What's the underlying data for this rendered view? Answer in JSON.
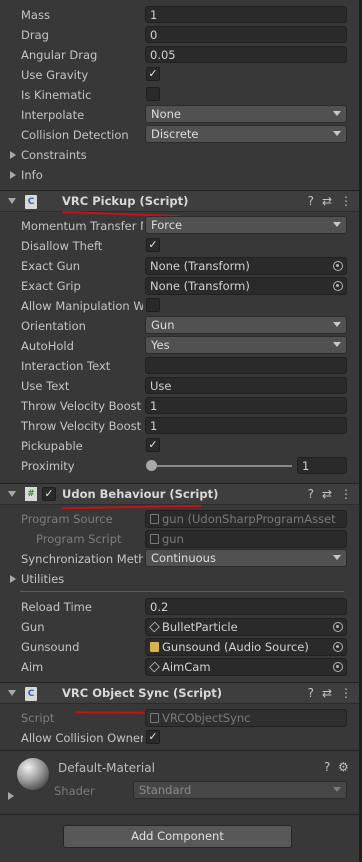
{
  "rigidbody": {
    "rows": [
      {
        "label": "Mass",
        "value": "1"
      },
      {
        "label": "Drag",
        "value": "0"
      },
      {
        "label": "Angular Drag",
        "value": "0.05"
      }
    ],
    "use_gravity_label": "Use Gravity",
    "is_kinematic_label": "Is Kinematic",
    "interpolate_label": "Interpolate",
    "interpolate_value": "None",
    "collision_label": "Collision Detection",
    "collision_value": "Discrete",
    "constraints_label": "Constraints",
    "info_label": "Info"
  },
  "pickup": {
    "title": "VRC Pickup (Script)",
    "momentum_label": "Momentum Transfer M",
    "momentum_value": "Force",
    "disallow_label": "Disallow Theft",
    "exact_gun_label": "Exact Gun",
    "exact_gun_value": "None (Transform)",
    "exact_grip_label": "Exact Grip",
    "exact_grip_value": "None (Transform)",
    "allow_manip_label": "Allow Manipulation Wl",
    "orientation_label": "Orientation",
    "orientation_value": "Gun",
    "autohold_label": "AutoHold",
    "autohold_value": "Yes",
    "interaction_label": "Interaction Text",
    "interaction_value": "",
    "use_text_label": "Use Text",
    "use_text_value": "Use",
    "throw1_label": "Throw Velocity Boost",
    "throw1_value": "1",
    "throw2_label": "Throw Velocity Boost",
    "throw2_value": "1",
    "pickupable_label": "Pickupable",
    "proximity_label": "Proximity",
    "proximity_value": "1"
  },
  "udon": {
    "title": "Udon Behaviour (Script)",
    "program_source_label": "Program Source",
    "program_source_value": "gun (UdonSharpProgramAsset",
    "program_script_label": "Program Script",
    "program_script_value": "gun",
    "sync_label": "Synchronization Meth",
    "sync_value": "Continuous",
    "utilities_label": "Utilities",
    "reload_label": "Reload Time",
    "reload_value": "0.2",
    "gun_label": "Gun",
    "gun_value": "BulletParticle",
    "gunsound_label": "Gunsound",
    "gunsound_value": "Gunsound (Audio Source)",
    "aim_label": "Aim",
    "aim_value": "AimCam"
  },
  "objectsync": {
    "title": "VRC Object Sync (Script)",
    "script_label": "Script",
    "script_value": "VRCObjectSync",
    "allow_collision_label": "Allow Collision Owner"
  },
  "material": {
    "name": "Default-Material",
    "shader_label": "Shader",
    "shader_value": "Standard"
  },
  "add_component_label": "Add Component",
  "icons": {
    "help": "?",
    "presets": "⇄",
    "menu": "⋮",
    "check": "✓",
    "settings": "⚙"
  },
  "colors": {
    "annotation_red": "#c8101a"
  }
}
